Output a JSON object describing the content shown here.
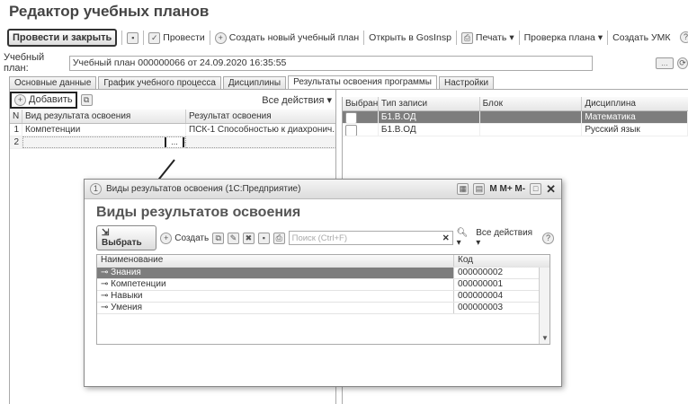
{
  "window": {
    "title": "Редактор учебных планов"
  },
  "toolbar": {
    "post_close": "Провести и закрыть",
    "post": "Провести",
    "create_plan": "Создать новый учебный план",
    "open_gosinsp": "Открыть в GosInsp",
    "print": "Печать",
    "check_plan": "Проверка плана",
    "create_umk": "Создать УМК"
  },
  "plan": {
    "label": "Учебный план:",
    "value": "Учебный план 000000066 от 24.09.2020 16:35:55"
  },
  "tabs": [
    "Основные данные",
    "График учебного процесса",
    "Дисциплины",
    "Результаты освоения программы",
    "Настройки"
  ],
  "left_grid": {
    "add_label": "Добавить",
    "all_actions": "Все действия",
    "headers": [
      "N",
      "Вид результата освоения",
      "Результат освоения"
    ],
    "rows": [
      {
        "n": "1",
        "kind": "Компетенции",
        "result": "ПСК-1 Способностью к диахронич..."
      },
      {
        "n": "2",
        "kind": "",
        "result": ""
      }
    ],
    "ellipsis": "..."
  },
  "right_grid": {
    "headers": [
      "Выбран",
      "Тип записи",
      "Блок",
      "Дисциплина"
    ],
    "rows": [
      {
        "type": "Б1.В.ОД",
        "block": "",
        "discipline": "Математика"
      },
      {
        "type": "Б1.В.ОД",
        "block": "",
        "discipline": "Русский язык"
      }
    ]
  },
  "dialog": {
    "window_title": "Виды результатов освоения (1С:Предприятие)",
    "heading": "Виды результатов освоения",
    "select_label": "Выбрать",
    "create_label": "Создать",
    "search_placeholder": "Поиск (Ctrl+F)",
    "all_actions": "Все действия",
    "col_name": "Наименование",
    "col_code": "Код",
    "title_buttons": "M  M+  M-",
    "rows": [
      {
        "name": "Знания",
        "code": "000000002"
      },
      {
        "name": "Компетенции",
        "code": "000000001"
      },
      {
        "name": "Навыки",
        "code": "000000004"
      },
      {
        "name": "Умения",
        "code": "000000003"
      }
    ]
  }
}
